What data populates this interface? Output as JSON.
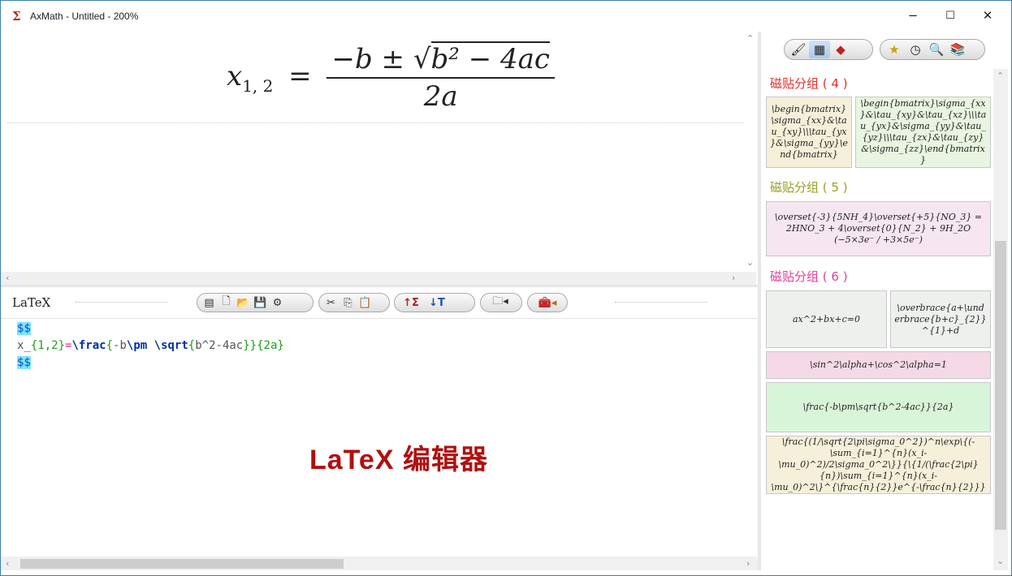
{
  "window": {
    "title": "AxMath - Untitled - 200%",
    "app_icon": "Σ",
    "minimize_glyph": "−",
    "maximize_glyph": "☐",
    "close_glyph": "✕"
  },
  "formula_pane": {
    "lhs": "x",
    "lhs_sub": "1, 2",
    "eq": "=",
    "numerator_pre": "−b ± ",
    "radicand": "b² − 4ac",
    "denominator": "2a"
  },
  "latex_bar": {
    "logo": "LaTeX"
  },
  "editor": {
    "line1": "$$",
    "line2_tokens": [
      {
        "t": "x_",
        "c": "plain"
      },
      {
        "t": "{1,2}",
        "c": "brace"
      },
      {
        "t": "=",
        "c": "eq"
      },
      {
        "t": "\\frac",
        "c": "cmd"
      },
      {
        "t": "{",
        "c": "brace"
      },
      {
        "t": "-b",
        "c": "plain"
      },
      {
        "t": "\\pm",
        "c": "cmd"
      },
      {
        "t": " ",
        "c": "plain"
      },
      {
        "t": "\\sqrt",
        "c": "cmd"
      },
      {
        "t": "{",
        "c": "brace"
      },
      {
        "t": "b^2-4ac",
        "c": "plain"
      },
      {
        "t": "}}",
        "c": "brace"
      },
      {
        "t": "{2a}",
        "c": "brace"
      }
    ],
    "line3": "$$"
  },
  "watermark": "LaTeX 编辑器",
  "right_panel": {
    "groups": [
      {
        "title": "磁贴分组 ( 4 )",
        "color": "#e0302a"
      },
      {
        "title": "磁贴分组 ( 5 )",
        "color": "#9aa020"
      },
      {
        "title": "磁贴分组 ( 6 )",
        "color": "#e0409a"
      }
    ],
    "tiles": [
      {
        "tex": "\\begin{bmatrix}\\sigma_{xx}&\\tau_{xy}\\\\\\tau_{yx}&\\sigma_{yy}\\end{bmatrix}",
        "bg": "#f6efd9"
      },
      {
        "tex": "\\begin{bmatrix}\\sigma_{xx}&\\tau_{xy}&\\tau_{xz}\\\\\\tau_{yx}&\\sigma_{yy}&\\tau_{yz}\\\\\\tau_{zx}&\\tau_{zy}&\\sigma_{zz}\\end{bmatrix}",
        "bg": "#e8f5e0"
      },
      {
        "tex": "\\overset{-3}{5NH_4}\\overset{+5}{NO_3} = 2HNO_3 + 4\\overset{0}{N_2} + 9H_2O  (−5×3e⁻ / +3×5e⁻)",
        "bg": "#f6e6f1"
      },
      {
        "tex": "ax^2+bx+c=0",
        "bg": "#eef0ee"
      },
      {
        "tex": "\\overbrace{a+\\underbrace{b+c}_{2}}^{1}+d",
        "bg": "#eef0ee"
      },
      {
        "tex": "\\sin^2\\alpha+\\cos^2\\alpha=1",
        "bg": "#f6d9e6"
      },
      {
        "tex": "\\frac{-b\\pm\\sqrt{b^2-4ac}}{2a}",
        "bg": "#d9f5d9"
      },
      {
        "tex": "\\frac{(1/\\sqrt{2\\pi\\sigma_0^2})^n\\exp\\{(-\\sum_{i=1}^{n}(x_i-\\mu_0)^2)/2\\sigma_0^2\\}}{\\{1/(\\frac{2\\pi}{n})\\sum_{i=1}^{n}(x_i-\\mu_0)^2\\}^{\\frac{n}{2}}e^{-\\frac{n}{2}}}",
        "bg": "#f6efd9"
      }
    ]
  }
}
